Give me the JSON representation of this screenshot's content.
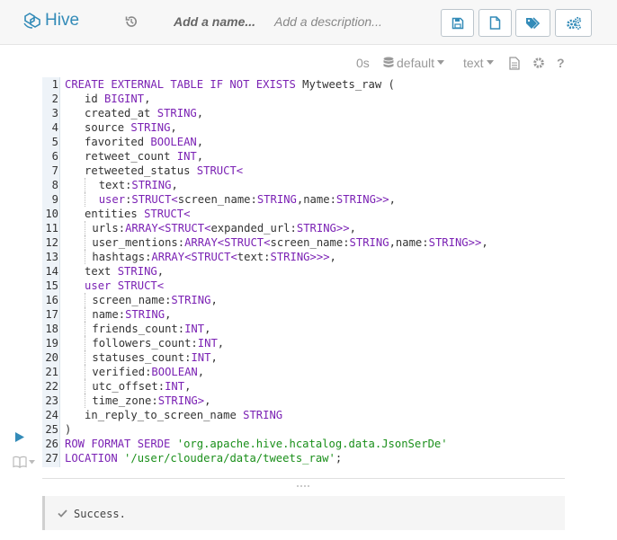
{
  "app": {
    "name": "Hive"
  },
  "topbar": {
    "name_placeholder": "Add a name...",
    "description_placeholder": "Add a description..."
  },
  "editor_toolbar": {
    "execution_time": "0s",
    "database": "default",
    "format": "text"
  },
  "code_lines": [
    {
      "n": "1"
    },
    {
      "n": "2"
    },
    {
      "n": "3"
    },
    {
      "n": "4"
    },
    {
      "n": "5"
    },
    {
      "n": "6"
    },
    {
      "n": "7"
    },
    {
      "n": "8"
    },
    {
      "n": "9"
    },
    {
      "n": "10"
    },
    {
      "n": "11"
    },
    {
      "n": "12"
    },
    {
      "n": "13"
    },
    {
      "n": "14"
    },
    {
      "n": "15"
    },
    {
      "n": "16"
    },
    {
      "n": "17"
    },
    {
      "n": "18"
    },
    {
      "n": "19"
    },
    {
      "n": "20"
    },
    {
      "n": "21"
    },
    {
      "n": "22"
    },
    {
      "n": "23"
    },
    {
      "n": "24"
    },
    {
      "n": "25"
    },
    {
      "n": "26"
    },
    {
      "n": "27"
    }
  ],
  "code": {
    "l1_kw": "CREATE EXTERNAL TABLE IF NOT EXISTS",
    "l1_rest": " Mytweets_raw (",
    "l2_id": "id",
    "l2_ty": "BIGINT",
    "l3_id": "created_at",
    "l3_ty": "STRING",
    "l4_id": "source",
    "l4_ty": "STRING",
    "l5_id": "favorited",
    "l5_ty": "BOOLEAN",
    "l6_id": "retweet_count",
    "l6_ty": "INT",
    "l7_id": "retweeted_status",
    "l7_ty": "STRUCT<",
    "l8_id": "text",
    "l8_ty": "STRING",
    "l9_id": "user",
    "l9_ty": "STRUCT<",
    "l9_f1": "screen_name",
    "l9_t1": "STRING",
    "l9_f2": "name",
    "l9_t2": "STRING>>",
    "l10_id": "entities",
    "l10_ty": "STRUCT<",
    "l11_id": "urls",
    "l11_ty": "ARRAY<STRUCT<",
    "l11_f1": "expanded_url",
    "l11_t1": "STRING>>",
    "l12_id": "user_mentions",
    "l12_ty": "ARRAY<STRUCT<",
    "l12_f1": "screen_name",
    "l12_t1": "STRING",
    "l12_f2": "name",
    "l12_t2": "STRING>>",
    "l13_id": "hashtags",
    "l13_ty": "ARRAY<STRUCT<",
    "l13_f1": "text",
    "l13_t1": "STRING>>>",
    "l14_id": "text",
    "l14_ty": "STRING",
    "l15_id": "user",
    "l15_ty": "STRUCT<",
    "l16_id": "screen_name",
    "l16_ty": "STRING",
    "l17_id": "name",
    "l17_ty": "STRING",
    "l18_id": "friends_count",
    "l18_ty": "INT",
    "l19_id": "followers_count",
    "l19_ty": "INT",
    "l20_id": "statuses_count",
    "l20_ty": "INT",
    "l21_id": "verified",
    "l21_ty": "BOOLEAN",
    "l22_id": "utc_offset",
    "l22_ty": "INT",
    "l23_id": "time_zone",
    "l23_ty": "STRING>",
    "l24_id": "in_reply_to_screen_name",
    "l24_ty": "STRING",
    "l25": ")",
    "l26_kw": "ROW FORMAT SERDE",
    "l26_str": "'org.apache.hive.hcatalog.data.JsonSerDe'",
    "l27_kw": "LOCATION",
    "l27_str": "'/user/cloudera/data/tweets_raw'",
    "l27_end": ";"
  },
  "result": {
    "status": "Success."
  },
  "colors": {
    "brand": "#338bb8",
    "keyword": "#7b22b4",
    "string": "#1a8f1a",
    "run": "#338bb8"
  }
}
